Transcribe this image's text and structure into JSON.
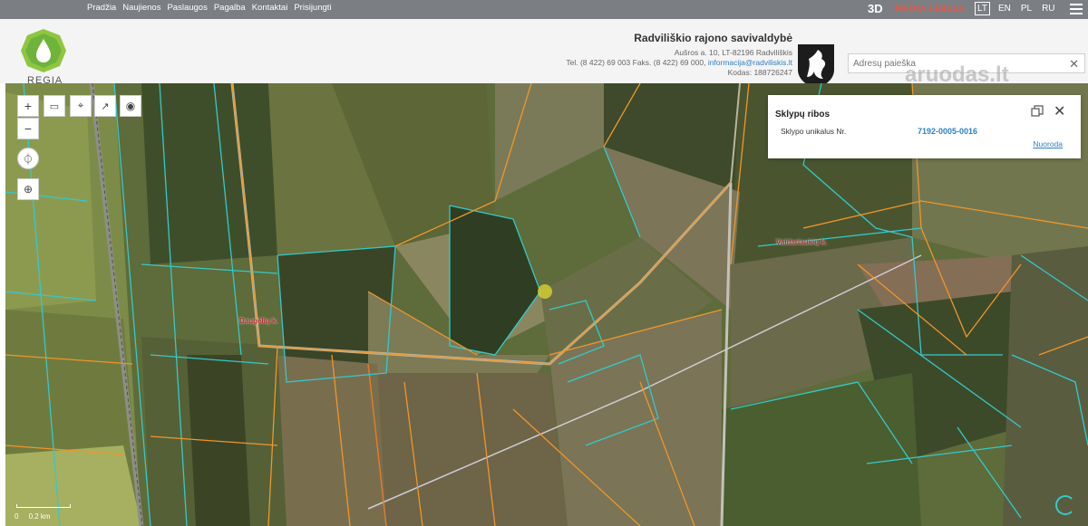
{
  "nav": {
    "links": [
      "Pradžia",
      "Naujienos",
      "Paslaugos",
      "Pagalba",
      "Kontaktai",
      "Prisijungti"
    ],
    "threed": "3D",
    "regia_lietuva": "REGIA Lietuva",
    "languages": [
      "LT",
      "EN",
      "PL",
      "RU"
    ]
  },
  "header": {
    "logo_text": "REGIA",
    "municipality_name": "Radviliškio rajono savivaldybė",
    "address": "Aušros a. 10, LT-82196 Radviliškis",
    "phones": "Tel. (8 422) 69 003 Faks. (8 422) 69 000,",
    "email": "informacija@radviliskis.lt",
    "code": "Kodas: 188726247",
    "search_placeholder": "Adresų paieška",
    "watermark": "aruodas.lt"
  },
  "popup": {
    "title": "Sklypų ribos",
    "label": "Sklypo unikalus Nr.",
    "value": "7192-0005-0016",
    "link": "Nuoroda"
  },
  "map": {
    "places": [
      "Valdarlaukių k.",
      "Daugėlių k."
    ],
    "scale": [
      "0",
      "0.2 km"
    ]
  },
  "colors": {
    "accent": "#2f7fc1",
    "parcel_cyan": "#35c9c9",
    "parcel_orange": "#f0962a",
    "brand_red": "#e2584a"
  }
}
